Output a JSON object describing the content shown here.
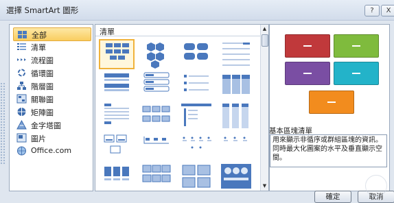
{
  "window": {
    "title": "選擇 SmartArt 圖形",
    "help_glyph": "?",
    "close_glyph": "X"
  },
  "categories": [
    {
      "label": "全部",
      "icon": "all-layouts-icon",
      "selected": true
    },
    {
      "label": "清單",
      "icon": "list-icon",
      "selected": false
    },
    {
      "label": "流程圖",
      "icon": "process-icon",
      "selected": false
    },
    {
      "label": "循環圖",
      "icon": "cycle-icon",
      "selected": false
    },
    {
      "label": "階層圖",
      "icon": "hierarchy-icon",
      "selected": false
    },
    {
      "label": "關聯圖",
      "icon": "relationship-icon",
      "selected": false
    },
    {
      "label": "矩陣圖",
      "icon": "matrix-icon",
      "selected": false
    },
    {
      "label": "金字塔圖",
      "icon": "pyramid-icon",
      "selected": false
    },
    {
      "label": "圖片",
      "icon": "picture-icon",
      "selected": false
    },
    {
      "label": "Office.com",
      "icon": "office-com-icon",
      "selected": false
    }
  ],
  "gallery": {
    "header": "清單",
    "scroll_up": "▲",
    "scroll_down": "▼",
    "selected_index": 0
  },
  "preview": {
    "box_colors": [
      "#c0393b",
      "#7fbb3d",
      "#7a4ea3",
      "#23b3c9",
      "#f28c1e"
    ],
    "name": "基本區塊清單",
    "description": "用來顯示非循序或群組區塊的資訊。同時最大化圖案的水平及垂直顯示空間。"
  },
  "buttons": {
    "ok": "確定",
    "cancel": "取消"
  }
}
